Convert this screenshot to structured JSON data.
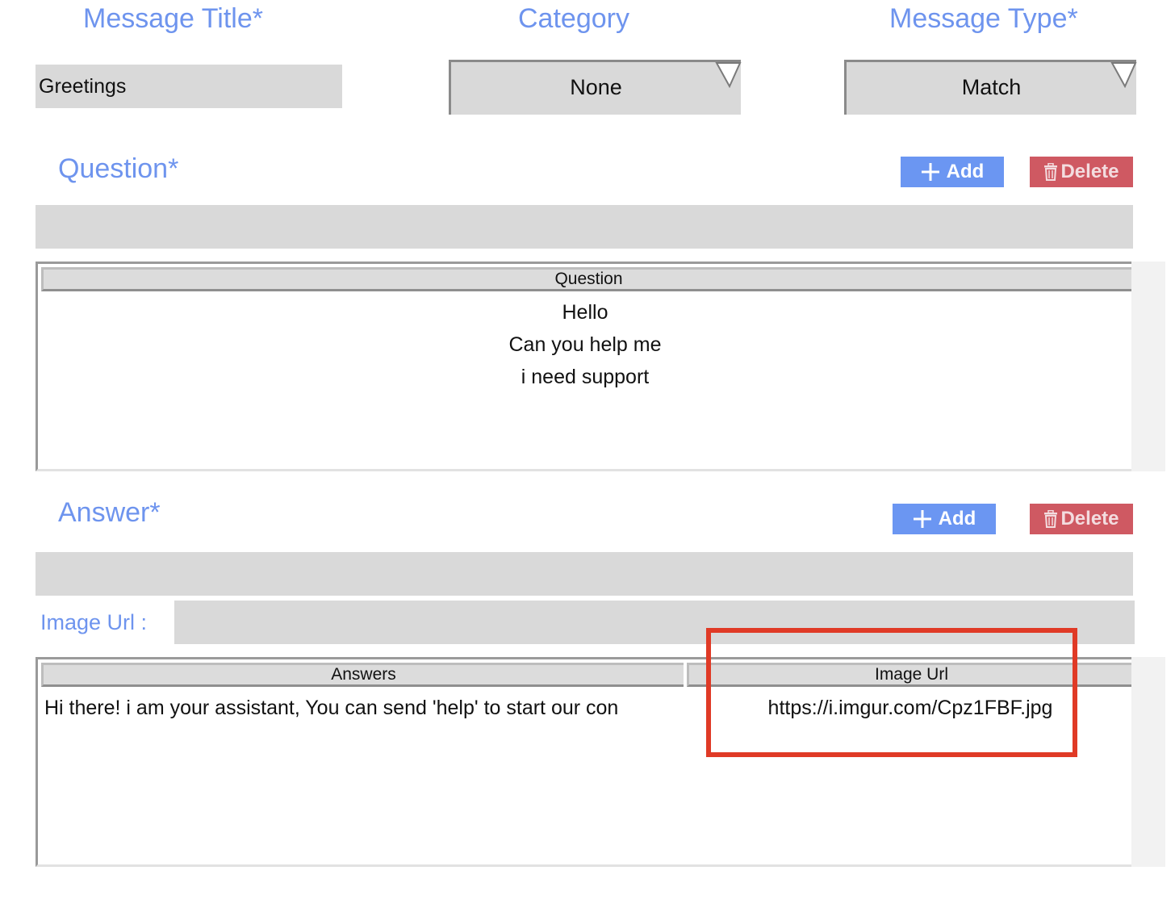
{
  "header": {
    "message_title_label": "Message Title*",
    "category_label": "Category",
    "message_type_label": "Message Type*"
  },
  "fields": {
    "message_title_value": "Greetings",
    "category_value": "None",
    "message_type_value": "Match"
  },
  "question": {
    "label": "Question*",
    "add_label": "Add",
    "delete_label": "Delete",
    "input_value": "",
    "table_header": "Question",
    "rows": [
      "Hello",
      "Can you help me",
      "i need support"
    ]
  },
  "answer": {
    "label": "Answer*",
    "add_label": "Add",
    "delete_label": "Delete",
    "input_value": "",
    "image_url_label": "Image Url :",
    "image_url_value": "",
    "table_headers": [
      "Answers",
      "Image Url"
    ],
    "rows": [
      {
        "answer": "Hi there! i am your assistant, You can send 'help' to start our con",
        "image_url": "https://i.imgur.com/Cpz1FBF.jpg"
      }
    ]
  },
  "colors": {
    "label_blue": "#6e94ee",
    "add_button": "#6b96f2",
    "delete_button": "#cf5962",
    "field_gray": "#d9d9d9",
    "highlight_red": "#e03a26"
  },
  "icons": {
    "add": "plus-icon",
    "delete": "trash-icon",
    "dropdown": "dropdown-triangle-icon"
  }
}
